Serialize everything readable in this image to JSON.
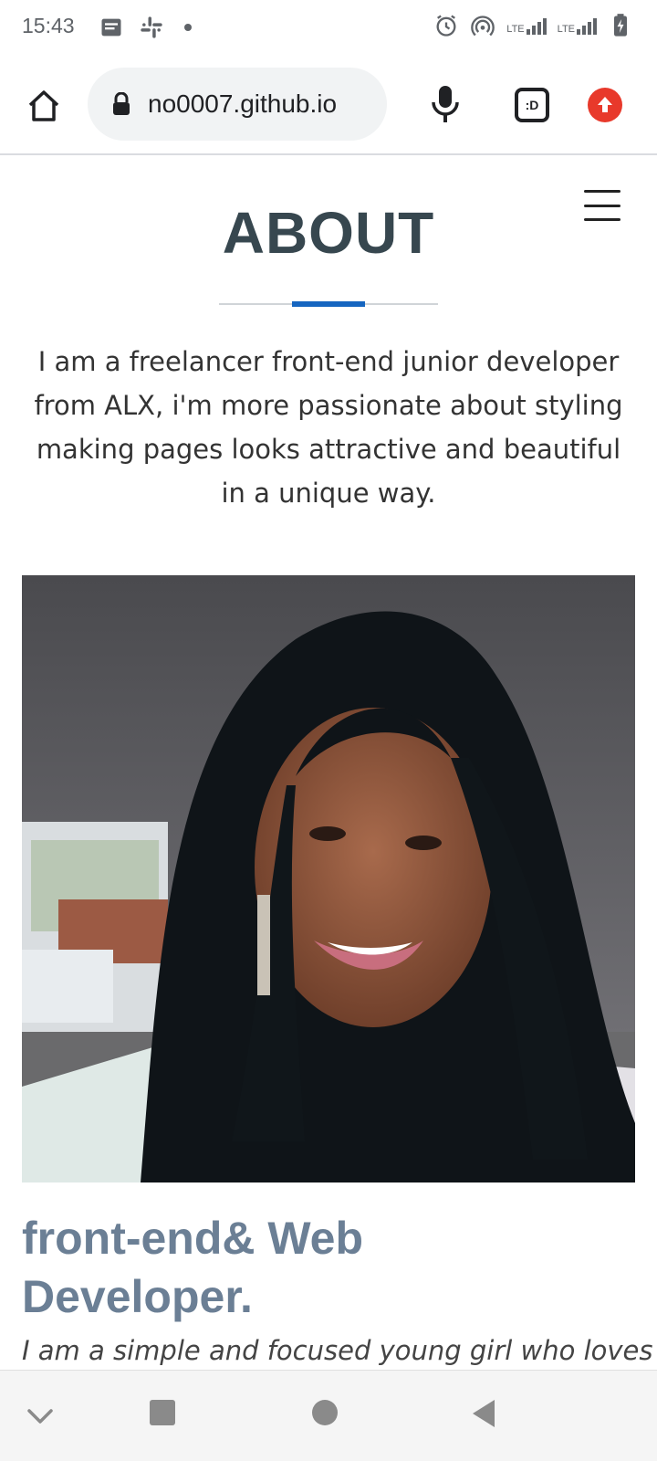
{
  "status_bar": {
    "time": "15:43",
    "left_icons": [
      "message-icon",
      "slack-icon",
      "notification-dot-icon"
    ],
    "right_icons": [
      "alarm-icon",
      "hotspot-icon",
      "lte-signal-icon",
      "lte-signal-icon",
      "battery-charging-icon"
    ],
    "network_label": "LTE",
    "network_label_2": "LTE"
  },
  "browser": {
    "url": "no0007.github.io",
    "tabs_label": ":D",
    "icons": [
      "home-icon",
      "lock-icon",
      "mic-icon",
      "tabs-icon",
      "update-icon"
    ],
    "update_color": "#e8392b"
  },
  "page": {
    "section_title": "ABOUT",
    "about_text": "I am a freelancer front-end junior developer from ALX, i'm more passionate about styling making pages looks attractive and beautiful in a unique way.",
    "role_title": "front-end& Web Developer.",
    "role_description": "I am a simple and focused young girl who loves",
    "accent_color": "#1565c0",
    "scroll_top_color": "#0b63bd"
  },
  "nav_bar": {
    "icons": [
      "collapse-chevron-icon",
      "recents-icon",
      "home-circle-icon",
      "back-icon"
    ]
  }
}
